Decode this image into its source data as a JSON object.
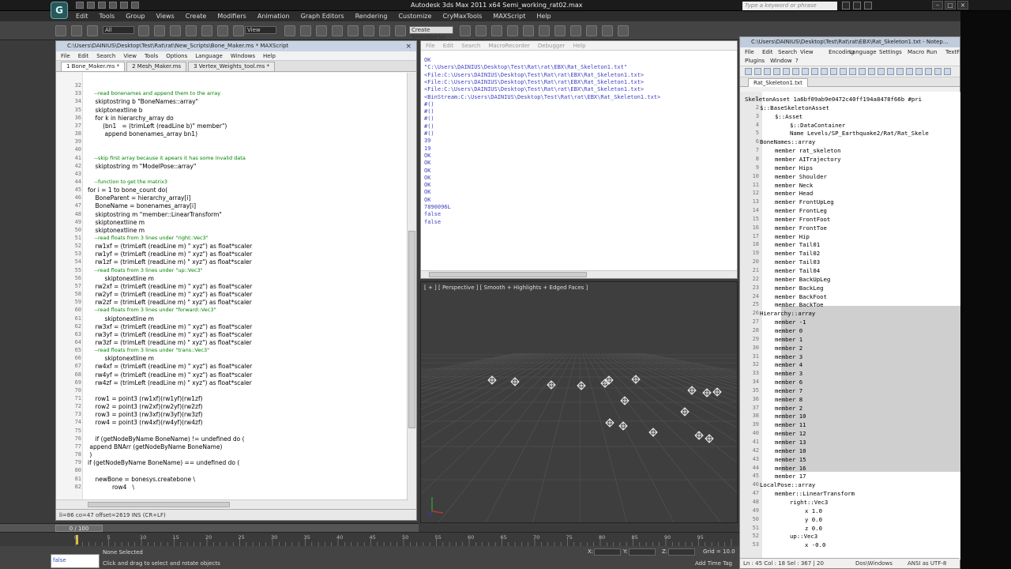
{
  "app": {
    "title": "Autodesk 3ds Max  2011 x64     Semi_working_rat02.max",
    "logo": "G",
    "search_placeholder": "Type a keyword or phrase"
  },
  "menubar": [
    "Edit",
    "Tools",
    "Group",
    "Views",
    "Create",
    "Modifiers",
    "Animation",
    "Graph Editors",
    "Rendering",
    "Customize",
    "CryMaxTools",
    "MAXScript",
    "Help"
  ],
  "toolbar": {
    "selection_filter": "All",
    "ref_coord": "View",
    "named_selection": "Create Selection Se"
  },
  "maxscript": {
    "title": "C:\\Users\\DAINIUS\\Desktop\\Test\\Rat\\rat\\New_Scripts\\Bone_Maker.ms * MAXScript",
    "menu": [
      "File",
      "Edit",
      "Search",
      "View",
      "Tools",
      "Options",
      "Language",
      "Windows",
      "Help"
    ],
    "tabs": [
      "1 Bone_Maker.ms *",
      "2 Mesh_Maker.ms",
      "3 Vertex_Weights_tool.ms *"
    ],
    "status": "li=86 co=47 offset=2619 INS (CR+LF)",
    "lines": [
      {
        "n": "",
        "t": "",
        "c": false
      },
      {
        "n": "32",
        "t": "",
        "c": false
      },
      {
        "n": "33",
        "t": "    --read bonenames and append them to the array",
        "c": true
      },
      {
        "n": "34",
        "t": "    skiptostring b \"BoneNames::array\"",
        "c": false
      },
      {
        "n": "35",
        "t": "    skiptonextline b",
        "c": false
      },
      {
        "n": "36",
        "t": "    for k in hierarchy_array do",
        "c": false
      },
      {
        "n": "37",
        "t": "        (bn1   = (trimLeft (readLine b)\" member\")",
        "c": false
      },
      {
        "n": "38",
        "t": "         append bonenames_array bn1)",
        "c": false
      },
      {
        "n": "39",
        "t": "",
        "c": false
      },
      {
        "n": "40",
        "t": "",
        "c": false
      },
      {
        "n": "41",
        "t": "    --skip first array because it apears it has some invalid data",
        "c": true
      },
      {
        "n": "42",
        "t": "    skiptostring m \"ModelPose::array\"",
        "c": false
      },
      {
        "n": "43",
        "t": "",
        "c": false
      },
      {
        "n": "44",
        "t": "    --function to get the matrix3",
        "c": true
      },
      {
        "n": "45",
        "t": "for i = 1 to bone_count do(",
        "c": false
      },
      {
        "n": "46",
        "t": "    BoneParent = hierarchy_array[i]",
        "c": false
      },
      {
        "n": "47",
        "t": "    BoneName = bonenames_array[i]",
        "c": false
      },
      {
        "n": "48",
        "t": "    skiptostring m \"member::LinearTransform\"",
        "c": false
      },
      {
        "n": "49",
        "t": "    skiptonextline m",
        "c": false
      },
      {
        "n": "50",
        "t": "    skiptonextline m",
        "c": false
      },
      {
        "n": "51",
        "t": "    --read floats from 3 lines under \"right::Vec3\"",
        "c": true
      },
      {
        "n": "52",
        "t": "    rw1xf = (trimLeft (readLine m) \" xyz\") as float*scaler",
        "c": false
      },
      {
        "n": "53",
        "t": "    rw1yf = (trimLeft (readLine m) \" xyz\") as float*scaler",
        "c": false
      },
      {
        "n": "54",
        "t": "    rw1zf = (trimLeft (readLine m) \" xyz\") as float*scaler",
        "c": false
      },
      {
        "n": "55",
        "t": "    --read floats from 3 lines under \"up::Vec3\"",
        "c": true
      },
      {
        "n": "56",
        "t": "         skiptonextline m",
        "c": false
      },
      {
        "n": "57",
        "t": "    rw2xf = (trimLeft (readLine m) \" xyz\") as float*scaler",
        "c": false
      },
      {
        "n": "58",
        "t": "    rw2yf = (trimLeft (readLine m) \" xyz\") as float*scaler",
        "c": false
      },
      {
        "n": "59",
        "t": "    rw2zf = (trimLeft (readLine m) \" xyz\") as float*scaler",
        "c": false
      },
      {
        "n": "60",
        "t": "    --read floats from 3 lines under \"forward::Vec3\"",
        "c": true
      },
      {
        "n": "61",
        "t": "         skiptonextline m",
        "c": false
      },
      {
        "n": "62",
        "t": "    rw3xf = (trimLeft (readLine m) \" xyz\") as float*scaler",
        "c": false
      },
      {
        "n": "63",
        "t": "    rw3yf = (trimLeft (readLine m) \" xyz\") as float*scaler",
        "c": false
      },
      {
        "n": "64",
        "t": "    rw3zf = (trimLeft (readLine m) \" xyz\") as float*scaler",
        "c": false
      },
      {
        "n": "65",
        "t": "    --read floats from 3 lines under \"trans::Vec3\"",
        "c": true
      },
      {
        "n": "66",
        "t": "         skiptonextline m",
        "c": false
      },
      {
        "n": "67",
        "t": "    rw4xf = (trimLeft (readLine m) \" xyz\") as float*scaler",
        "c": false
      },
      {
        "n": "68",
        "t": "    rw4yf = (trimLeft (readLine m) \" xyz\") as float*scaler",
        "c": false
      },
      {
        "n": "69",
        "t": "    rw4zf = (trimLeft (readLine m) \" xyz\") as float*scaler",
        "c": false
      },
      {
        "n": "70",
        "t": "",
        "c": false
      },
      {
        "n": "71",
        "t": "    row1 = point3 (rw1xf)(rw1yf)(rw1zf)",
        "c": false
      },
      {
        "n": "72",
        "t": "    row2 = point3 (rw2xf)(rw2yf)(rw2zf)",
        "c": false
      },
      {
        "n": "73",
        "t": "    row3 = point3 (rw3xf)(rw3yf)(rw3zf)",
        "c": false
      },
      {
        "n": "74",
        "t": "    row4 = point3 (rw4xf)(rw4yf)(rw4zf)",
        "c": false
      },
      {
        "n": "75",
        "t": "",
        "c": false
      },
      {
        "n": "76",
        "t": "    if (getNodeByName BoneName) != undefined do (",
        "c": false
      },
      {
        "n": "77",
        "t": " append BNArr (getNodeByName BoneName)",
        "c": false
      },
      {
        "n": "78",
        "t": " )",
        "c": false
      },
      {
        "n": "79",
        "t": "if (getNodeByName BoneName) == undefined do (",
        "c": false
      },
      {
        "n": "80",
        "t": "",
        "c": false
      },
      {
        "n": "81",
        "t": "    newBone = bonesys.createbone \\",
        "c": false
      },
      {
        "n": "82",
        "t": "             row4   \\",
        "c": false
      }
    ]
  },
  "listener": {
    "menu": [
      "File",
      "Edit",
      "Search",
      "MacroRecorder",
      "Debugger",
      "Help"
    ],
    "lines": [
      "OK",
      "\"C:\\Users\\DAINIUS\\Desktop\\Test\\Rat\\rat\\EBX\\Rat_Skeleton1.txt\"",
      "<File:C:\\Users\\DAINIUS\\Desktop\\Test\\Rat\\rat\\EBX\\Rat_Skeleton1.txt>",
      "<File:C:\\Users\\DAINIUS\\Desktop\\Test\\Rat\\rat\\EBX\\Rat_Skeleton1.txt>",
      "<File:C:\\Users\\DAINIUS\\Desktop\\Test\\Rat\\rat\\EBX\\Rat_Skeleton1.txt>",
      "<BinStream:C:\\Users\\DAINIUS\\Desktop\\Test\\Rat\\rat\\EBX\\Rat_Skeleton1.txt>",
      "#()",
      "#()",
      "#()",
      "#()",
      "#()",
      "39",
      "19",
      "OK",
      "OK",
      "OK",
      "OK",
      "OK",
      "OK",
      "OK",
      "7890096L",
      "false",
      "false"
    ]
  },
  "viewport": {
    "label": "[ + ] [ Perspective ] [ Smooth + Highlights + Edged Faces ]"
  },
  "notepad": {
    "title": "C:\\Users\\DAINIUS\\Desktop\\Test\\Rat\\rat\\EBX\\Rat_Skeleton1.txt - Notep...",
    "menu_row1": [
      "File",
      "Edit",
      "Search",
      "View",
      "Encoding",
      "Language",
      "Settings",
      "Macro",
      "Run",
      "TextFX"
    ],
    "menu_row2": [
      "Plugins",
      "Window",
      "?"
    ],
    "tab": "Rat_Skeleton1.txt",
    "status": {
      "pos": "Ln : 45   Col : 18   Sel : 367 | 20",
      "eol": "Dos\\Windows",
      "enc": "ANSI as UTF-8"
    },
    "lines": [
      {
        "n": "1",
        "t": "SkeletonAsset 1a6bf09ab9e0472c40ff194a8478f66b #pri",
        "i": 0
      },
      {
        "n": "2",
        "t": "$::BaseSkeletonAsset",
        "i": 1
      },
      {
        "n": "3",
        "t": "$::Asset",
        "i": 2
      },
      {
        "n": "4",
        "t": "$::DataContainer",
        "i": 3
      },
      {
        "n": "5",
        "t": "Name Levels/SP_Earthquake2/Rat/Rat_Skele",
        "i": 3
      },
      {
        "n": "6",
        "t": "BoneNames::array",
        "i": 1
      },
      {
        "n": "7",
        "t": "member rat_skeleton",
        "i": 2
      },
      {
        "n": "8",
        "t": "member AITrajectory",
        "i": 2
      },
      {
        "n": "9",
        "t": "member Hips",
        "i": 2
      },
      {
        "n": "10",
        "t": "member Shoulder",
        "i": 2
      },
      {
        "n": "11",
        "t": "member Neck",
        "i": 2
      },
      {
        "n": "12",
        "t": "member Head",
        "i": 2
      },
      {
        "n": "13",
        "t": "member FrontUpLeg",
        "i": 2
      },
      {
        "n": "14",
        "t": "member FrontLeg",
        "i": 2
      },
      {
        "n": "15",
        "t": "member FrontFoot",
        "i": 2
      },
      {
        "n": "16",
        "t": "member FrontToe",
        "i": 2
      },
      {
        "n": "17",
        "t": "member Hip",
        "i": 2
      },
      {
        "n": "18",
        "t": "member Tail01",
        "i": 2
      },
      {
        "n": "19",
        "t": "member Tail02",
        "i": 2
      },
      {
        "n": "20",
        "t": "member Tail03",
        "i": 2
      },
      {
        "n": "21",
        "t": "member Tail04",
        "i": 2
      },
      {
        "n": "22",
        "t": "member BackUpLeg",
        "i": 2
      },
      {
        "n": "23",
        "t": "member BackLeg",
        "i": 2
      },
      {
        "n": "24",
        "t": "member BackFoot",
        "i": 2
      },
      {
        "n": "25",
        "t": "member BackToe",
        "i": 2
      },
      {
        "n": "26",
        "t": "Hierarchy::array",
        "i": 1
      },
      {
        "n": "27",
        "t": "member -1",
        "i": 2
      },
      {
        "n": "28",
        "t": "member 0",
        "i": 2
      },
      {
        "n": "29",
        "t": "member 1",
        "i": 2
      },
      {
        "n": "30",
        "t": "member 2",
        "i": 2
      },
      {
        "n": "31",
        "t": "member 3",
        "i": 2
      },
      {
        "n": "32",
        "t": "member 4",
        "i": 2
      },
      {
        "n": "33",
        "t": "member 3",
        "i": 2
      },
      {
        "n": "34",
        "t": "member 6",
        "i": 2
      },
      {
        "n": "35",
        "t": "member 7",
        "i": 2
      },
      {
        "n": "36",
        "t": "member 8",
        "i": 2
      },
      {
        "n": "37",
        "t": "member 2",
        "i": 2
      },
      {
        "n": "38",
        "t": "member 10",
        "i": 2
      },
      {
        "n": "39",
        "t": "member 11",
        "i": 2
      },
      {
        "n": "40",
        "t": "member 12",
        "i": 2
      },
      {
        "n": "41",
        "t": "member 13",
        "i": 2
      },
      {
        "n": "42",
        "t": "member 10",
        "i": 2
      },
      {
        "n": "43",
        "t": "member 15",
        "i": 2
      },
      {
        "n": "44",
        "t": "member 16",
        "i": 2
      },
      {
        "n": "45",
        "t": "member 17",
        "i": 2
      },
      {
        "n": "46",
        "t": "LocalPose::array",
        "i": 1
      },
      {
        "n": "47",
        "t": "member::LinearTransform",
        "i": 2
      },
      {
        "n": "48",
        "t": "right::Vec3",
        "i": 3
      },
      {
        "n": "49",
        "t": "x 1.0",
        "i": 4
      },
      {
        "n": "50",
        "t": "y 0.0",
        "i": 4
      },
      {
        "n": "51",
        "t": "z 0.0",
        "i": 4
      },
      {
        "n": "52",
        "t": "up::Vec3",
        "i": 3
      },
      {
        "n": "53",
        "t": "x -0.0",
        "i": 4
      }
    ]
  },
  "timeline": {
    "slider": "0 / 100",
    "ticks": [
      "0",
      "5",
      "10",
      "15",
      "20",
      "25",
      "30",
      "35",
      "40",
      "45",
      "50",
      "55",
      "60",
      "65",
      "70",
      "75",
      "80",
      "85",
      "90",
      "95"
    ]
  },
  "status": {
    "maxscript_mini": "false",
    "selection": "None Selected",
    "prompt": "Click and drag to select and rotate objects",
    "x_label": "X:",
    "y_label": "Y:",
    "z_label": "Z:",
    "grid": "Grid = 10.0",
    "add_time_tag": "Add Time Tag"
  }
}
